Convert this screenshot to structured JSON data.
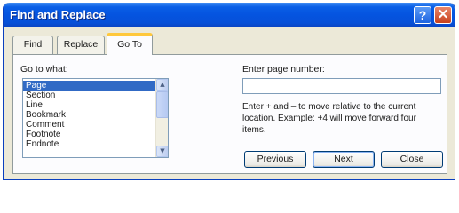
{
  "window": {
    "title": "Find and Replace"
  },
  "titlebar_buttons": {
    "help_label": "?",
    "close_label": "✕"
  },
  "tabs": [
    {
      "label": "Find",
      "active": false
    },
    {
      "label": "Replace",
      "active": false
    },
    {
      "label": "Go To",
      "active": true
    }
  ],
  "goto": {
    "goto_label": "Go to what:",
    "items": [
      "Page",
      "Section",
      "Line",
      "Bookmark",
      "Comment",
      "Footnote",
      "Endnote"
    ],
    "selected": "Page",
    "page_label": "Enter page number:",
    "page_value": "",
    "help_text": "Enter + and – to move relative to the current location. Example: +4 will move forward four items."
  },
  "buttons": {
    "previous": "Previous",
    "next": "Next",
    "close": "Close"
  },
  "icons": {
    "scroll_up": "▲",
    "scroll_down": "▼"
  },
  "colors": {
    "title_bar": "#0554e0",
    "selection": "#316ac5",
    "active_tab_accent": "#ffc83c"
  }
}
